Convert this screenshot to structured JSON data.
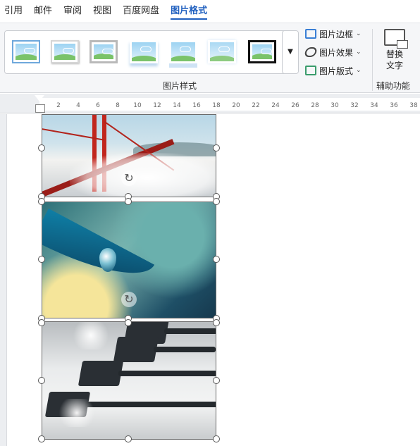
{
  "ribbon_tabs": [
    {
      "label": "引用"
    },
    {
      "label": "邮件"
    },
    {
      "label": "审阅"
    },
    {
      "label": "视图"
    },
    {
      "label": "百度网盘"
    },
    {
      "label": "图片格式",
      "active": true
    }
  ],
  "picture_styles": {
    "group_label": "图片样式",
    "thumbnails": [
      "picture-style-1",
      "picture-style-2",
      "picture-style-3",
      "picture-style-4",
      "picture-style-5",
      "picture-style-6",
      "picture-style-7"
    ],
    "more_icon": "chevron-down-icon"
  },
  "commands": {
    "border": "图片边框",
    "effects": "图片效果",
    "layout": "图片版式"
  },
  "accessibility": {
    "group_label": "辅助功能",
    "alt_text_line1": "替换",
    "alt_text_line2": "文字"
  },
  "ruler": {
    "ticks": [
      "2",
      "4",
      "6",
      "8",
      "10",
      "12",
      "14",
      "16",
      "18",
      "20",
      "22",
      "24",
      "26",
      "28",
      "30",
      "32",
      "34",
      "36",
      "38"
    ]
  },
  "colors": {
    "accent": "#1f5fbf",
    "ribbon_bg": "#f5f6f8"
  },
  "document": {
    "images": [
      "bridge-photo",
      "water-drop-photo",
      "oars-photo"
    ],
    "selected_count": 3
  }
}
